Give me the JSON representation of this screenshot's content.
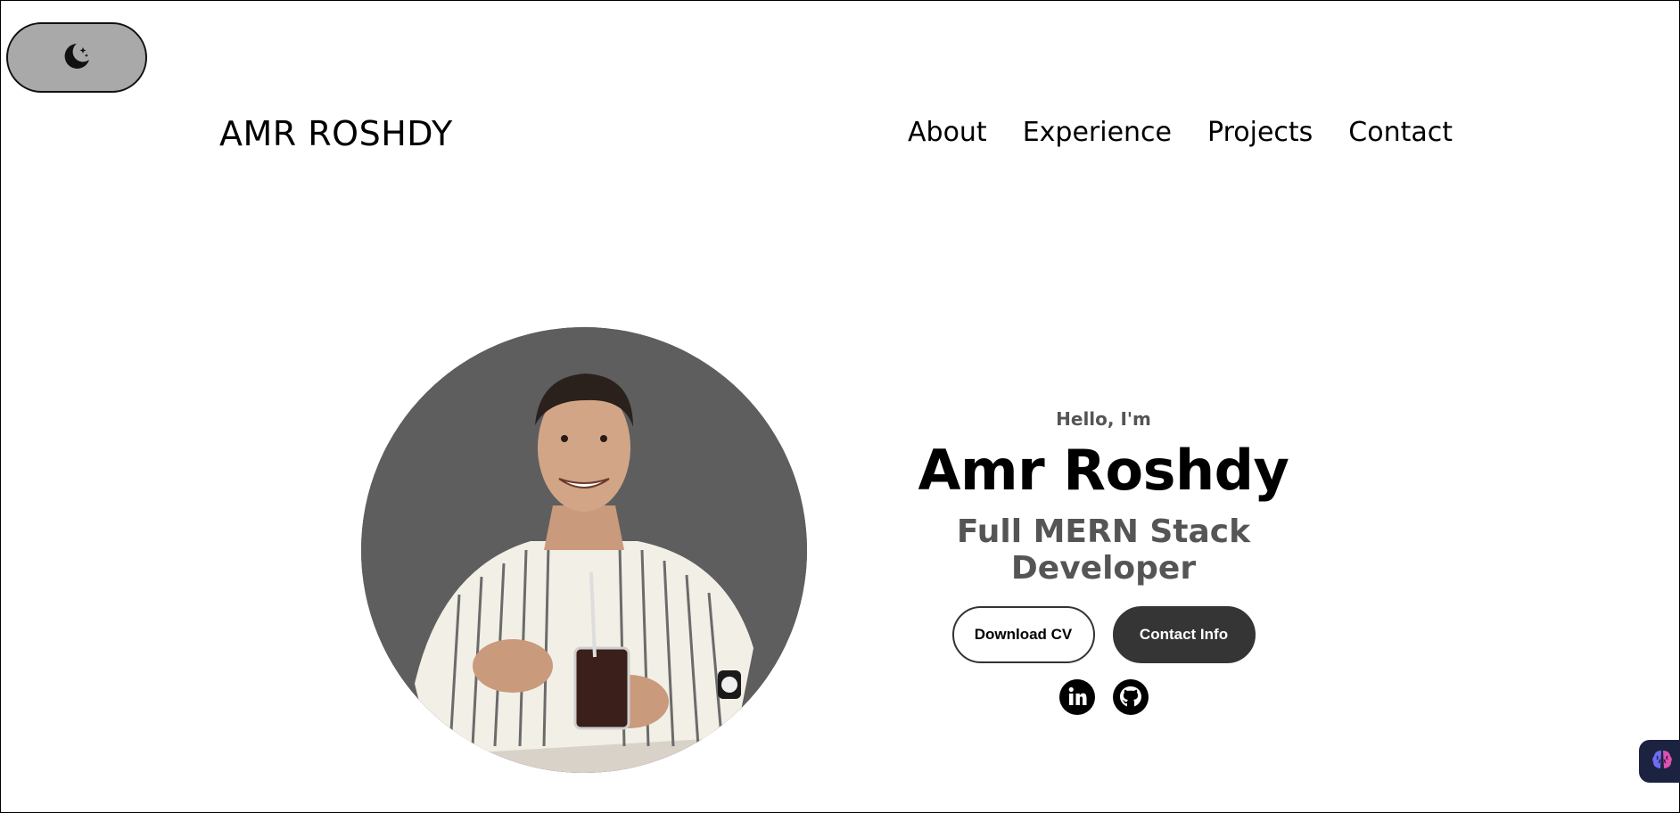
{
  "theme_toggle": {
    "icon": "moon-stars-icon"
  },
  "header": {
    "logo": "AMR ROSHDY",
    "nav": [
      {
        "label": "About"
      },
      {
        "label": "Experience"
      },
      {
        "label": "Projects"
      },
      {
        "label": "Contact"
      }
    ]
  },
  "hero": {
    "greeting": "Hello, I'm",
    "name": "Amr Roshdy",
    "role": "Full MERN Stack Developer",
    "download_cv_label": "Download CV",
    "contact_info_label": "Contact Info",
    "socials": [
      {
        "icon": "linkedin-icon"
      },
      {
        "icon": "github-icon"
      }
    ]
  },
  "colors": {
    "photo_bg": "#5e5e5e",
    "toggle_bg": "#a9a9a9",
    "solid_button": "#353535",
    "muted_text": "#555555"
  }
}
